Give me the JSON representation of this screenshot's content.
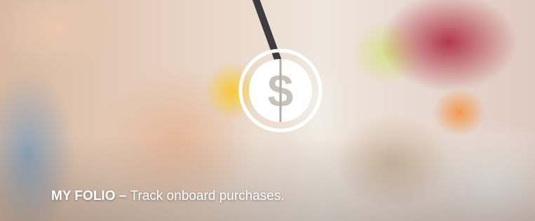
{
  "banner": {
    "title": "MY FOLIO",
    "separator": " – ",
    "description": "Track onboard purchases.",
    "icon": "dollar-coin-icon",
    "text_color": "#ffffff"
  }
}
